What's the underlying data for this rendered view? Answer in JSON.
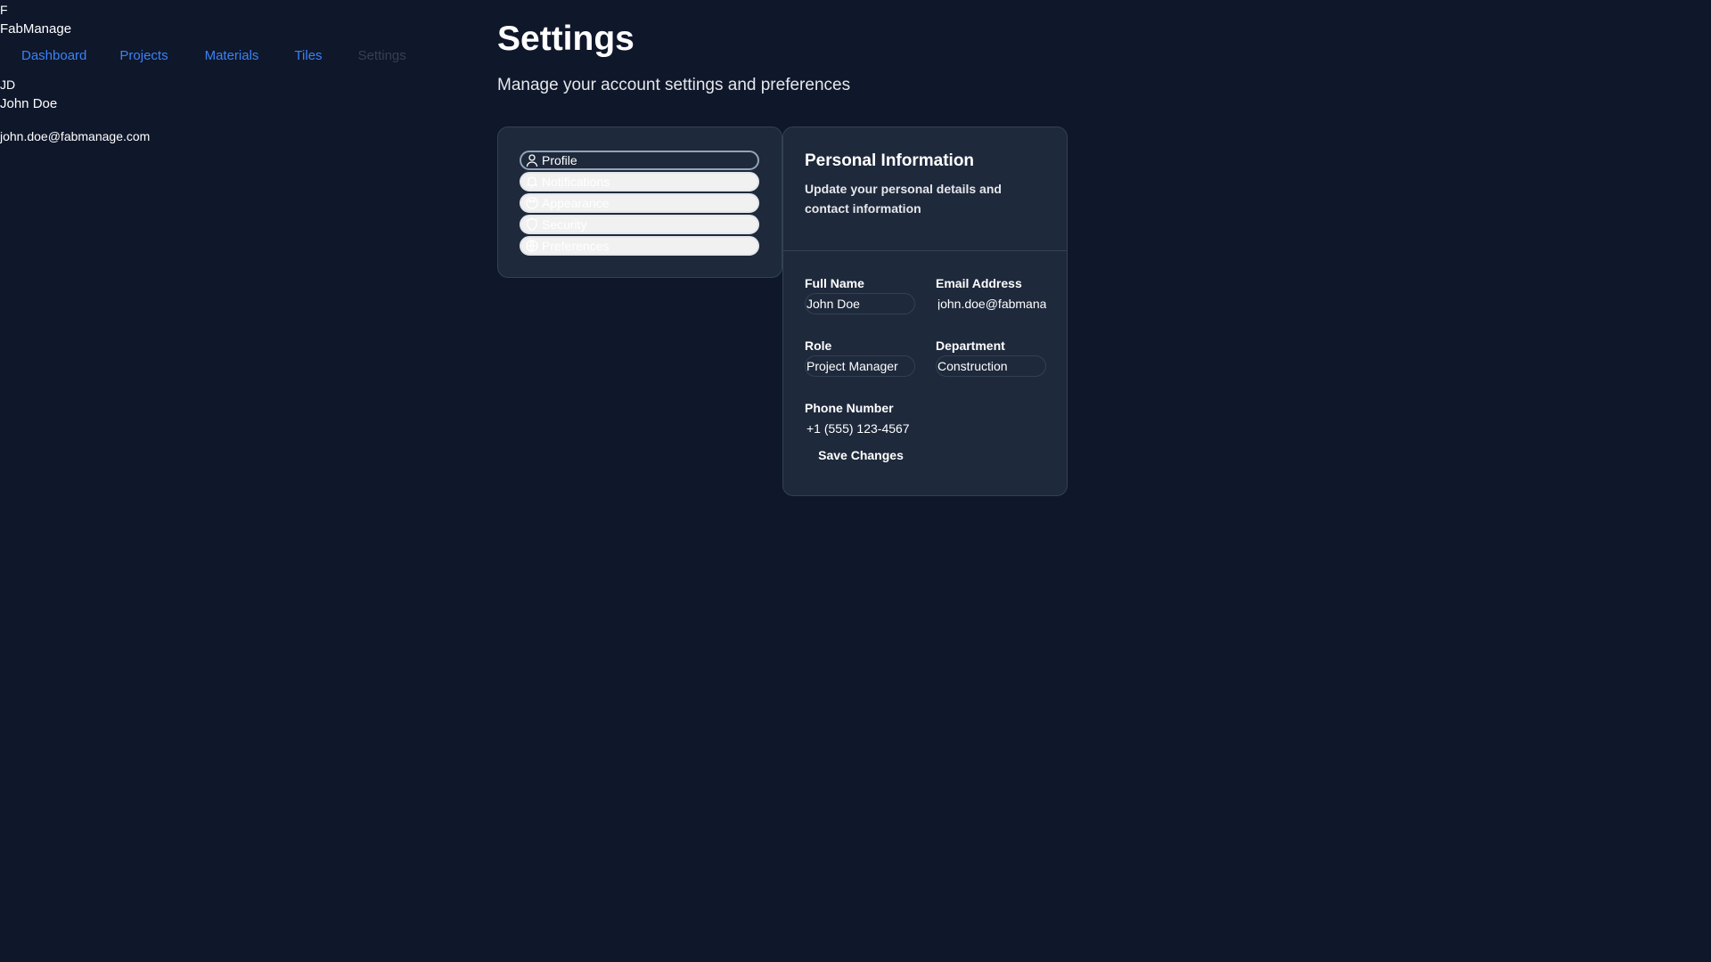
{
  "app": {
    "logo_letter": "F",
    "brand": "FabManage"
  },
  "nav": {
    "items": [
      {
        "label": "Dashboard"
      },
      {
        "label": "Projects"
      },
      {
        "label": "Materials"
      },
      {
        "label": "Tiles"
      },
      {
        "label": "Settings",
        "active": true
      }
    ]
  },
  "user": {
    "initials": "JD",
    "name": "John Doe",
    "email": "john.doe@fabmanage.com"
  },
  "page": {
    "title": "Settings",
    "subtitle": "Manage your account settings and preferences"
  },
  "tabs": [
    {
      "label": "Profile",
      "icon": "user-icon",
      "active": true
    },
    {
      "label": "Notifications",
      "icon": "bell-icon"
    },
    {
      "label": "Appearance",
      "icon": "palette-icon"
    },
    {
      "label": "Security",
      "icon": "shield-icon"
    },
    {
      "label": "Preferences",
      "icon": "globe-icon"
    }
  ],
  "personal_info": {
    "title": "Personal Information",
    "description": "Update your personal details and contact information",
    "fields": {
      "full_name": {
        "label": "Full Name",
        "value": "John Doe"
      },
      "email": {
        "label": "Email Address",
        "value": "john.doe@fabmanage.com"
      },
      "role": {
        "label": "Role",
        "value": "Project Manager"
      },
      "department": {
        "label": "Department",
        "value": "Construction"
      },
      "phone": {
        "label": "Phone Number",
        "value": "+1 (555) 123-4567"
      }
    },
    "save_label": "Save Changes"
  },
  "colors": {
    "background": "#0f172a",
    "card": "#1e293b",
    "border": "#334155",
    "link": "#3b82f6"
  }
}
